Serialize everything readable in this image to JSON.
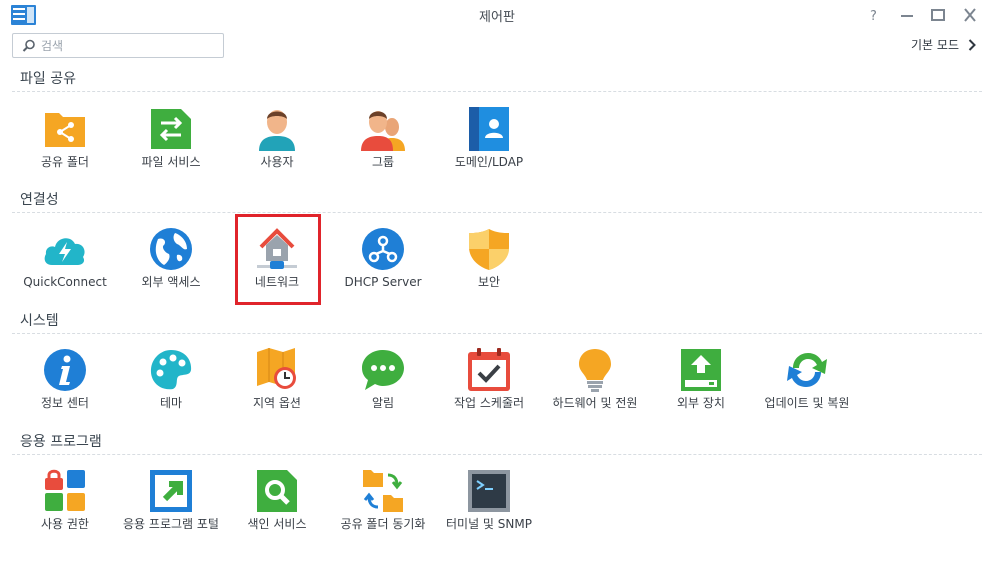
{
  "window": {
    "title": "제어판",
    "help_icon": "help-icon",
    "minimize_icon": "minimize-icon",
    "maximize_icon": "maximize-icon",
    "close_icon": "close-icon"
  },
  "search": {
    "placeholder": "검색",
    "value": ""
  },
  "mode_link": {
    "label": "기본 모드",
    "icon": "chevron-right-icon"
  },
  "sections": {
    "file_sharing": {
      "title": "파일 공유",
      "items": [
        {
          "label": "공유 폴더",
          "icon": "shared-folder-icon"
        },
        {
          "label": "파일 서비스",
          "icon": "file-services-icon"
        },
        {
          "label": "사용자",
          "icon": "user-icon"
        },
        {
          "label": "그룹",
          "icon": "group-icon"
        },
        {
          "label": "도메인/LDAP",
          "icon": "domain-ldap-icon"
        }
      ]
    },
    "connectivity": {
      "title": "연결성",
      "items": [
        {
          "label": "QuickConnect",
          "icon": "quickconnect-icon"
        },
        {
          "label": "외부 액세스",
          "icon": "external-access-icon"
        },
        {
          "label": "네트워크",
          "icon": "network-icon"
        },
        {
          "label": "DHCP Server",
          "icon": "dhcp-server-icon"
        },
        {
          "label": "보안",
          "icon": "security-icon"
        }
      ]
    },
    "system": {
      "title": "시스템",
      "items": [
        {
          "label": "정보 센터",
          "icon": "info-center-icon"
        },
        {
          "label": "테마",
          "icon": "theme-icon"
        },
        {
          "label": "지역 옵션",
          "icon": "regional-options-icon"
        },
        {
          "label": "알림",
          "icon": "notification-icon"
        },
        {
          "label": "작업 스케줄러",
          "icon": "task-scheduler-icon"
        },
        {
          "label": "하드웨어 및 전원",
          "icon": "hardware-power-icon"
        },
        {
          "label": "외부 장치",
          "icon": "external-devices-icon"
        },
        {
          "label": "업데이트 및 복원",
          "icon": "update-restore-icon"
        }
      ]
    },
    "applications": {
      "title": "응용 프로그램",
      "items": [
        {
          "label": "사용 권한",
          "icon": "app-privileges-icon"
        },
        {
          "label": "응용 프로그램 포털",
          "icon": "application-portal-icon"
        },
        {
          "label": "색인 서비스",
          "icon": "indexing-service-icon"
        },
        {
          "label": "공유 폴더 동기화",
          "icon": "shared-folder-sync-icon"
        },
        {
          "label": "터미널 및 SNMP",
          "icon": "terminal-snmp-icon"
        }
      ]
    }
  },
  "colors": {
    "highlight": "#e0242b",
    "blue": "#1f8ee0",
    "orange": "#f5a623",
    "green": "#3fae3f",
    "red": "#e84c3d"
  }
}
